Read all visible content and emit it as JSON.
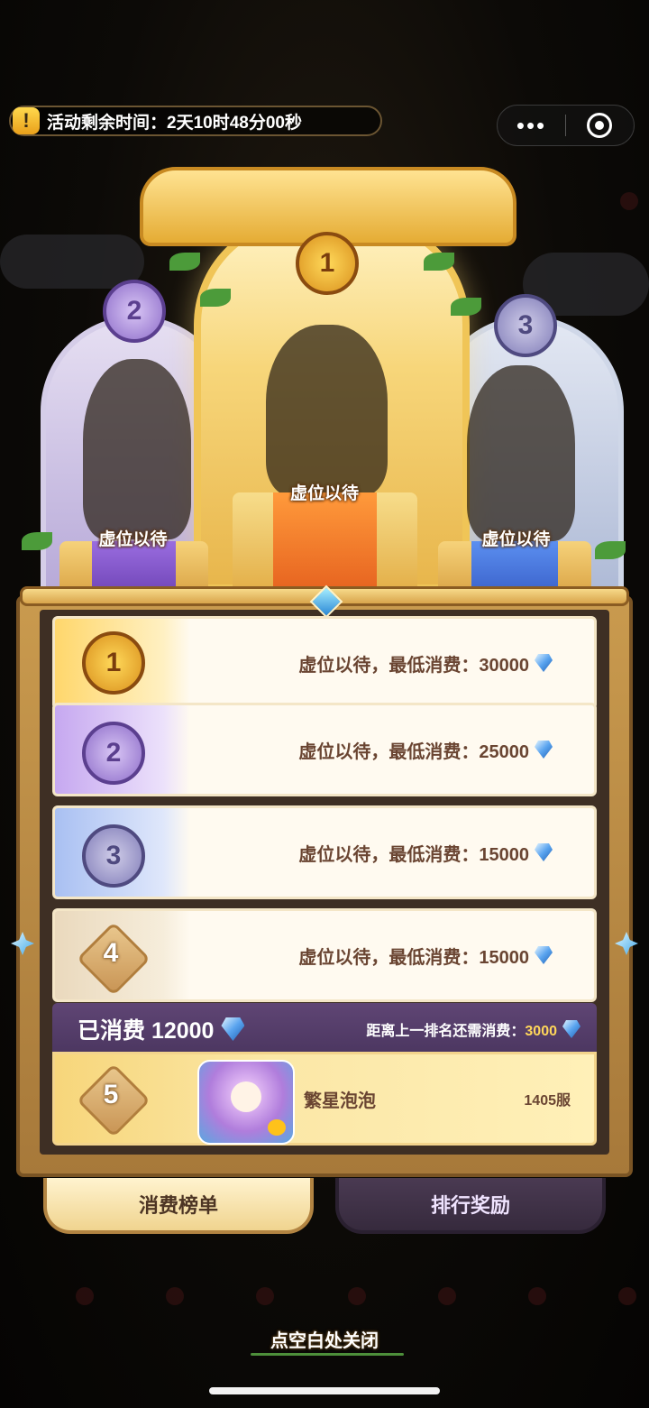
{
  "activity_timer": {
    "label": "活动剩余时间：2天10时48分00秒"
  },
  "mini_program_capsule": {
    "more": "•••"
  },
  "podium": {
    "first": {
      "rank": "1",
      "label": "虚位以待"
    },
    "second": {
      "rank": "2",
      "label": "虚位以待"
    },
    "third": {
      "rank": "3",
      "label": "虚位以待"
    }
  },
  "ranking_rows": [
    {
      "rank": "1",
      "text": "虚位以待，最低消费：30000"
    },
    {
      "rank": "2",
      "text": "虚位以待，最低消费：25000"
    },
    {
      "rank": "3",
      "text": "虚位以待，最低消费：15000"
    },
    {
      "rank": "4",
      "text": "虚位以待，最低消费：15000"
    }
  ],
  "my_rank": {
    "spent_label": "已消费 12000",
    "need_label": "距离上一排名还需消费：",
    "need_value": "3000",
    "rank": "5",
    "name": "繁星泡泡",
    "server": "1405服"
  },
  "tabs": {
    "consumption_list": "消费榜单",
    "ranking_rewards": "排行奖励"
  },
  "close_hint": "点空白处关闭",
  "colors": {
    "gold": "#e5ac34",
    "purple": "#8d6cc9",
    "blue": "#807cb8",
    "panel": "#c99a4e",
    "my_header": "#5f4574"
  }
}
